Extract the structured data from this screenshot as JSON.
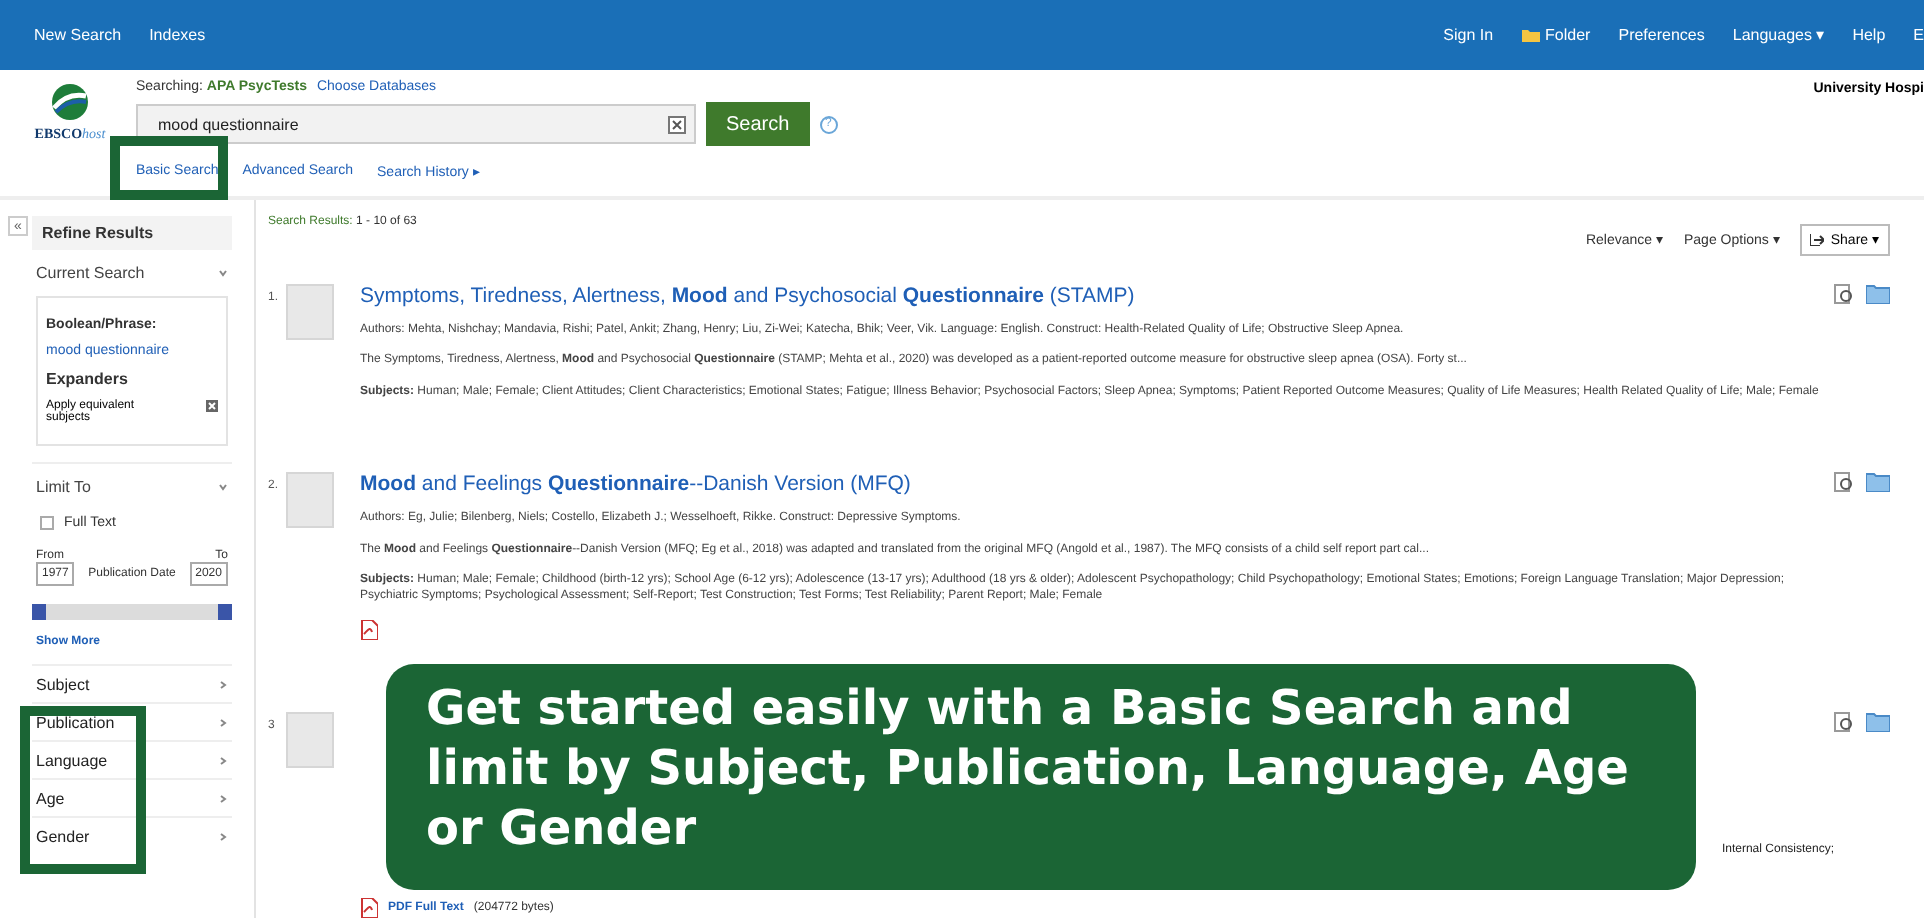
{
  "top_bar": {
    "left_links": [
      "New Search",
      "Indexes"
    ],
    "right_links": [
      {
        "label": "Sign In",
        "kind": "link"
      },
      {
        "label": "Folder",
        "kind": "folder"
      },
      {
        "label": "Preferences",
        "kind": "link"
      },
      {
        "label": "Languages ▾",
        "kind": "link"
      },
      {
        "label": "Help",
        "kind": "link"
      },
      {
        "label": "E",
        "kind": "link"
      }
    ]
  },
  "header": {
    "logo": {
      "brand": "EBSCO",
      "suffix": "host"
    },
    "searching_label": "Searching:",
    "database": "APA PsycTests",
    "choose_databases": "Choose Databases",
    "search_field": {
      "value": "mood questionnaire"
    },
    "search_button": "Search",
    "help": "?",
    "links": [
      "Basic Search",
      "Advanced Search",
      "Search History ▸"
    ],
    "institution": "University Hospi"
  },
  "sidebar": {
    "collapse": "«",
    "title": "Refine Results",
    "current_search": {
      "title": "Current Search",
      "boolean_label": "Boolean/Phrase:",
      "query": "mood questionnaire",
      "expanders_label": "Expanders",
      "expander": "Apply equivalent subjects"
    },
    "limit_to": {
      "title": "Limit To",
      "full_text": {
        "label": "Full Text",
        "checked": false
      },
      "from_label": "From",
      "to_label": "To",
      "from": "1977",
      "to": "2020",
      "date_label": "Publication Date",
      "slider": {
        "level": 1
      }
    },
    "show_more": "Show More",
    "facets": [
      "Subject",
      "Publication",
      "Language",
      "Age",
      "Gender"
    ]
  },
  "results": {
    "summary_label": "Search Results:",
    "summary": "1 - 10 of 63",
    "sort": "Relevance ▾",
    "page_options": "Page Options ▾",
    "share": "Share ▾",
    "items": [
      {
        "number": "1.",
        "title": "Symptoms, Tiredness, Alertness, **Mood** and Psychosocial **Questionnaire** (STAMP)",
        "meta": "Authors: Mehta, Nishchay; Mandavia, Rishi; Patel, Ankit; Zhang, Henry; Liu, Zi-Wei; Katecha, Bhik; Veer, Vik. Language: English. Construct: Health-Related Quality of Life; Obstructive Sleep Apnea.",
        "abstract": "The Symptoms, Tiredness, Alertness, **Mood** and Psychosocial **Questionnaire** (STAMP; Mehta et al., 2020) was developed as a patient-reported outcome measure for obstructive sleep apnea (OSA). Forty st...",
        "subjects": "**Subjects:** Human; Male; Female; Client Attitudes; Client Characteristics; Emotional States; Fatigue; Illness Behavior; Psychosocial Factors; Sleep Apnea; Symptoms; Patient Reported Outcome Measures; Quality of Life Measures; Health Related Quality of Life; Male; Female",
        "pdf": false
      },
      {
        "number": "2.",
        "title": "**Mood** and Feelings **Questionnaire**--Danish Version (MFQ)",
        "meta": "Authors: Eg, Julie; Bilenberg, Niels; Costello, Elizabeth J.; Wesselhoeft, Rikke. Construct: Depressive Symptoms.",
        "abstract": "The **Mood** and Feelings **Questionnaire**--Danish Version (MFQ; Eg et al., 2018) was adapted and translated from the original MFQ (Angold et al., 1987). The MFQ consists of a child self report part cal...",
        "subjects": "**Subjects:** Human; Male; Female; Childhood (birth-12 yrs); School Age (6-12 yrs); Adolescence (13-17 yrs); Adulthood (18 yrs & older); Adolescent Psychopathology; Child Psychopathology; Emotional States; Emotions; Foreign Language Translation; Major Depression; Psychiatric Symptoms; Psychological Assessment; Self-Report; Test Construction; Test Forms; Test Reliability; Parent Report; Male; Female",
        "pdf": true
      },
      {
        "number": "3",
        "subjects": "Internal Consistency;",
        "pdf": true,
        "pdf_label": "PDF Full Text",
        "pdf_size": "(204772 bytes)"
      }
    ]
  },
  "callout": "Get started easily with a Basic Search and limit by Subject, Publication, Language, Age or Gender"
}
